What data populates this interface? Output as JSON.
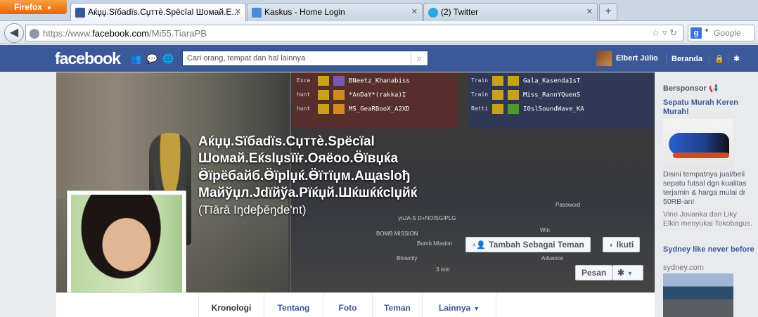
{
  "browser": {
    "app_button": "Firefox",
    "tabs": [
      {
        "title": "Aќџџ.Sїбadїs.Cџттѐ.Spёcїal Шомай.E...",
        "icon": "facebook-icon",
        "icon_color": "#3b5998",
        "active": true
      },
      {
        "title": "Kaskus - Home Login",
        "icon": "kaskus-icon",
        "icon_color": "#4a8ad8",
        "active": false
      },
      {
        "title": "(2) Twitter",
        "icon": "twitter-icon",
        "icon_color": "#2fa8e0",
        "active": false
      }
    ],
    "new_tab": "+",
    "url_prefix": "https://www.",
    "url_domain": "facebook.com",
    "url_path": "/Mi55.TiaraPB",
    "search_placeholder": "Google"
  },
  "facebook": {
    "logo": "facebook",
    "search_placeholder": "Cari orang, tempat dan hal lainnya",
    "user_name": "Elbert Júlio",
    "home_link": "Beranda",
    "brand_color": "#3b5998"
  },
  "profile": {
    "name": "Aќџџ.Sїбadїs.Cџттѐ.Spёcїal Шомай.Eќslџsїїғ.Oяёoo.Ӫївџќa Ӫїрёбайб.Ӫїрlџќ.Ӫїтїџм.Aщasloђ Майўџл.Jdїйўa.Pїќџй.Шќшќќclџйќ",
    "alternate_name": "(Tīārā Iŋdeƥēŋde'nt)",
    "buttons": {
      "add_friend": "Tambah Sebagai Teman",
      "follow": "Ikuti",
      "message": "Pesan"
    },
    "tabs": [
      "Kronologi",
      "Tentang",
      "Foto",
      "Teman",
      "Lainnya"
    ]
  },
  "cover_game": {
    "left_rows": [
      {
        "cls": "Exce",
        "name": "BNeetz_Khanabiss"
      },
      {
        "cls": "hunt",
        "name": "*AnDaY*(rakka)I"
      },
      {
        "cls": "hunt",
        "name": "MS_GeaRBooX_A2XD"
      }
    ],
    "right_rows": [
      {
        "cls": "Train",
        "name": "Gala_Kasenda1sT"
      },
      {
        "cls": "Train",
        "name": "Miss_RannYQuenS"
      },
      {
        "cls": "Batti",
        "name": "I0slSoundWave_KA"
      }
    ],
    "labels": {
      "password": "Password",
      "room": "ynJA-S D+NOISGIPLG",
      "mode": "Bomb Mission",
      "win": "Win",
      "time": "3 min",
      "advance": "Advance",
      "blowcity": "Blowcity",
      "bomb": "BOMB MISSION"
    }
  },
  "sidebar": {
    "heading": "Bersponsor",
    "ads": [
      {
        "title": "Sepatu Murah Keren Murah!",
        "text": "Disini tempatnya jual/beli sepatu futsal dgn kualitas terjamin & harga mulai dr 50RB-an!",
        "social": "Vino Jovanka dan Liky Elkin menyukai Tokobagus."
      },
      {
        "title": "Sydney like never before",
        "url": "sydney.com"
      }
    ]
  }
}
